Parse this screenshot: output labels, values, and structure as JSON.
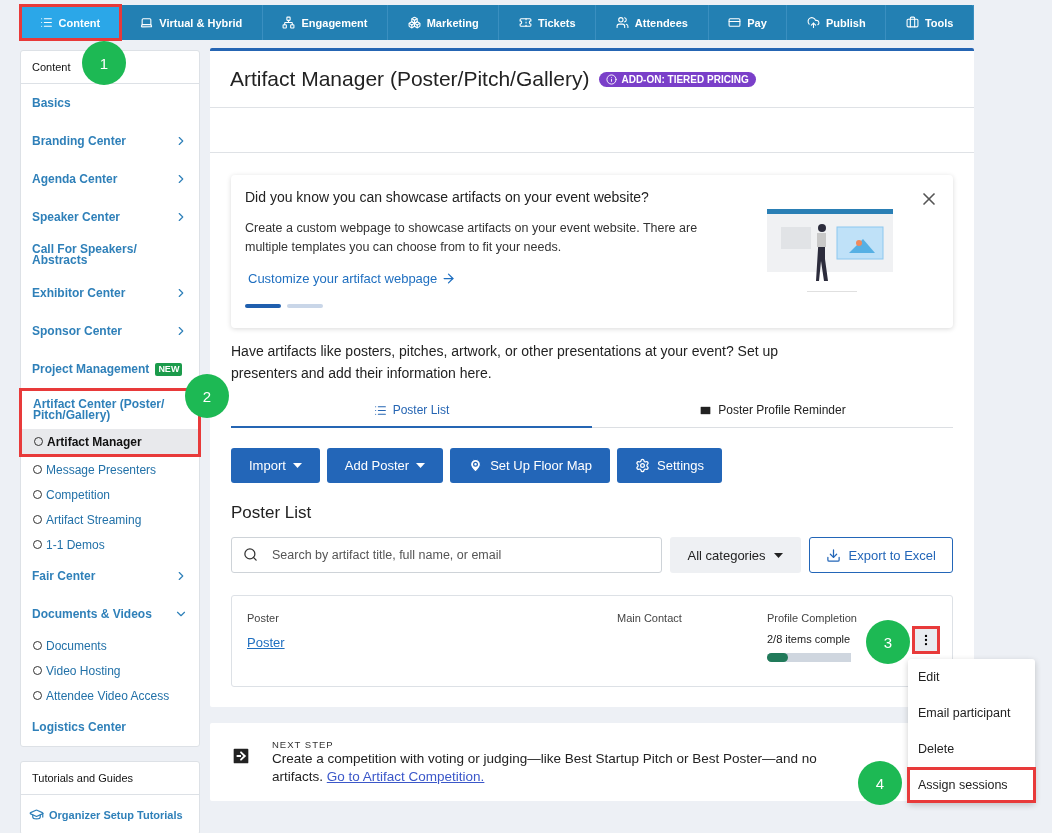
{
  "nav": [
    {
      "label": "Content",
      "selected": true,
      "highlighted": true,
      "callout": "1"
    },
    {
      "label": "Virtual & Hybrid",
      "selected": false,
      "highlighted": false
    },
    {
      "label": "Engagement",
      "selected": false,
      "highlighted": false
    },
    {
      "label": "Marketing",
      "selected": false,
      "highlighted": false
    },
    {
      "label": "Tickets",
      "selected": false,
      "highlighted": false
    },
    {
      "label": "Attendees",
      "selected": false,
      "highlighted": false
    },
    {
      "label": "Pay",
      "selected": false,
      "highlighted": false
    },
    {
      "label": "Publish",
      "selected": false,
      "highlighted": false
    },
    {
      "label": "Tools",
      "selected": false,
      "highlighted": false
    }
  ],
  "sidebar": {
    "title": "Content",
    "items": [
      {
        "label": "Basics"
      },
      {
        "label": "Branding Center",
        "expanded": false
      },
      {
        "label": "Agenda Center",
        "expanded": false
      },
      {
        "label": "Speaker Center",
        "expanded": false
      },
      {
        "label": "Call For Speakers/ Abstracts"
      },
      {
        "label": "Exhibitor Center",
        "expanded": false
      },
      {
        "label": "Sponsor Center",
        "expanded": false
      },
      {
        "label": "Project Management",
        "badge": "NEW"
      },
      {
        "label": "Artifact Center (Poster/ Pitch/Gallery)",
        "highlighted": true,
        "callout": "2",
        "children": [
          {
            "label": "Artifact Manager",
            "selected": true,
            "highlighted": true
          },
          {
            "label": "Message Presenters",
            "selected": false,
            "highlighted": false
          },
          {
            "label": "Competition",
            "selected": false,
            "highlighted": false
          },
          {
            "label": "Artifact Streaming",
            "selected": false,
            "highlighted": false
          },
          {
            "label": "1-1 Demos",
            "selected": false,
            "highlighted": false
          }
        ]
      },
      {
        "label": "Fair Center",
        "expanded": false
      },
      {
        "label": "Documents & Videos",
        "expanded": true,
        "children": [
          {
            "label": "Documents",
            "selected": false,
            "highlighted": false
          },
          {
            "label": "Video Hosting",
            "selected": false,
            "highlighted": false
          },
          {
            "label": "Attendee Video Access",
            "selected": false,
            "highlighted": false
          }
        ]
      },
      {
        "label": "Logistics Center"
      }
    ]
  },
  "tutorials": {
    "title": "Tutorials and Guides",
    "link": "Organizer Setup Tutorials"
  },
  "page": {
    "title": "Artifact Manager (Poster/Pitch/Gallery)",
    "badge": "ADD-ON: TIERED PRICING"
  },
  "promo": {
    "title": "Did you know you can showcase artifacts on your event website?",
    "body": "Create a custom webpage to showcase artifacts on your event website. There are multiple templates you can choose from to fit your needs.",
    "link": "Customize your artifact webpage",
    "slides": [
      {
        "selected": true
      },
      {
        "selected": false
      }
    ]
  },
  "intro": "Have artifacts like posters, pitches, artwork, or other presentations at your event? Set up presenters and add their information here.",
  "tabs": [
    {
      "label": "Poster List",
      "selected": true
    },
    {
      "label": "Poster Profile Reminder",
      "selected": false
    }
  ],
  "actions": [
    {
      "label": "Import",
      "kind": "dropdown"
    },
    {
      "label": "Add Poster",
      "kind": "dropdown"
    },
    {
      "label": "Set Up Floor Map",
      "kind": "map"
    },
    {
      "label": "Settings",
      "kind": "settings"
    }
  ],
  "list": {
    "title": "Poster List",
    "search_placeholder": "Search by artifact title, full name, or email",
    "category": "All categories",
    "export": "Export to Excel"
  },
  "table": {
    "columns": [
      "Poster",
      "Main Contact",
      "Profile Completion"
    ],
    "rows": [
      {
        "poster": "Poster",
        "completion": "2/8 items comple",
        "level": 0.25,
        "menu_highlighted": true,
        "callout": "3"
      }
    ]
  },
  "menu": [
    {
      "label": "Edit",
      "highlighted": false
    },
    {
      "label": "Email participant",
      "highlighted": false
    },
    {
      "label": "Delete",
      "highlighted": false
    },
    {
      "label": "Assign sessions",
      "highlighted": true,
      "callout": "4"
    }
  ],
  "next_step": {
    "label": "NEXT STEP",
    "text": "Create a competition with voting or judging—like Best Startup Pitch or Best Poster—and no",
    "text2": "artifacts.",
    "link": "Go to Artifact Competition."
  }
}
